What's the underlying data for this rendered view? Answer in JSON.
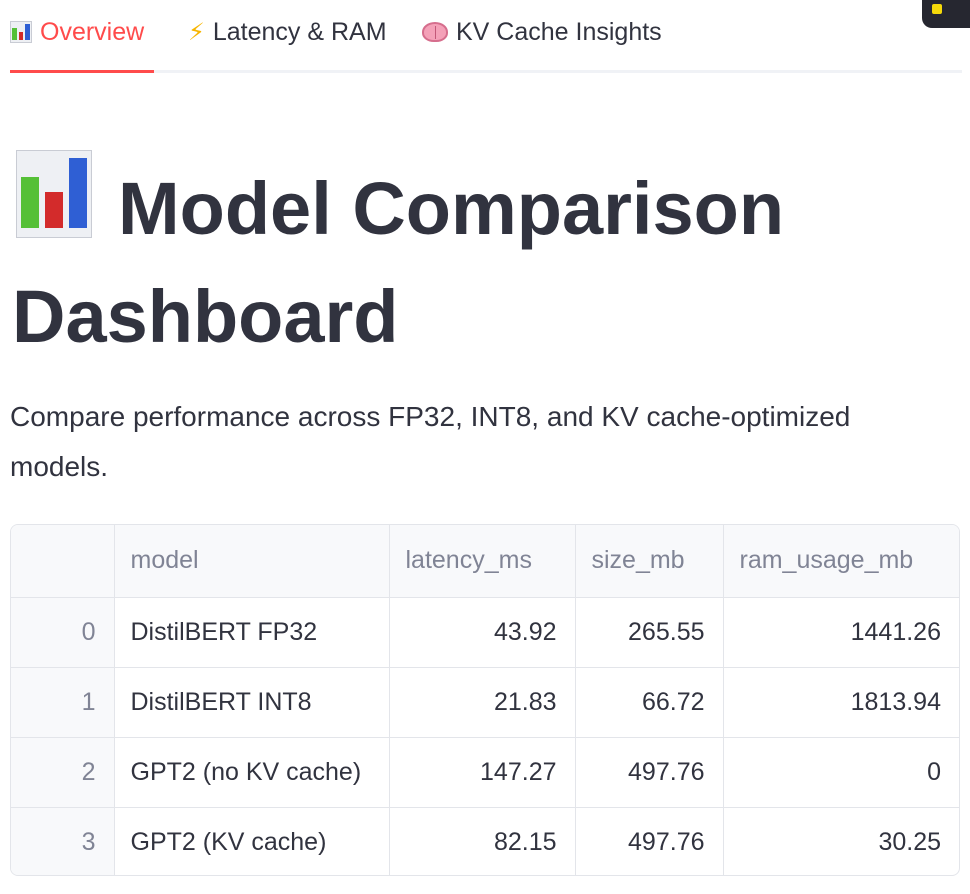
{
  "tabs": [
    {
      "label": "Overview",
      "icon": "bar-chart-icon",
      "active": true
    },
    {
      "label": "Latency & RAM",
      "icon": "lightning-bolt-icon",
      "active": false
    },
    {
      "label": "KV Cache Insights",
      "icon": "brain-icon",
      "active": false
    }
  ],
  "header": {
    "title": "Model Comparison Dashboard",
    "subtitle": "Compare performance across FP32, INT8, and KV cache-optimized models."
  },
  "colors": {
    "accent": "#ff4b4b",
    "text": "#31333f",
    "muted": "#808495"
  },
  "table": {
    "columns": [
      "",
      "model",
      "latency_ms",
      "size_mb",
      "ram_usage_mb"
    ],
    "rows": [
      {
        "index": "0",
        "model": "DistilBERT FP32",
        "latency_ms": "43.92",
        "size_mb": "265.55",
        "ram_usage_mb": "1441.26"
      },
      {
        "index": "1",
        "model": "DistilBERT INT8",
        "latency_ms": "21.83",
        "size_mb": "66.72",
        "ram_usage_mb": "1813.94"
      },
      {
        "index": "2",
        "model": "GPT2 (no KV cache)",
        "latency_ms": "147.27",
        "size_mb": "497.76",
        "ram_usage_mb": "0"
      },
      {
        "index": "3",
        "model": "GPT2 (KV cache)",
        "latency_ms": "82.15",
        "size_mb": "497.76",
        "ram_usage_mb": "30.25"
      }
    ]
  }
}
